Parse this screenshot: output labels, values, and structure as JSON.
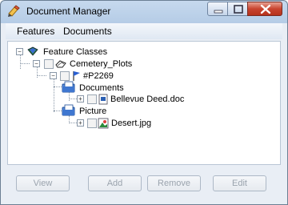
{
  "window": {
    "title": "Document Manager"
  },
  "menu": {
    "features": "Features",
    "documents": "Documents"
  },
  "tree": {
    "root": "Feature Classes",
    "layer": "Cemetery_Plots",
    "feature": "#P2269",
    "folder_documents": "Documents",
    "doc_file": "Bellevue Deed.doc",
    "folder_picture": "Picture",
    "pic_file": "Desert.jpg"
  },
  "buttons": {
    "view": "View",
    "add": "Add",
    "remove": "Remove",
    "edit": "Edit"
  }
}
